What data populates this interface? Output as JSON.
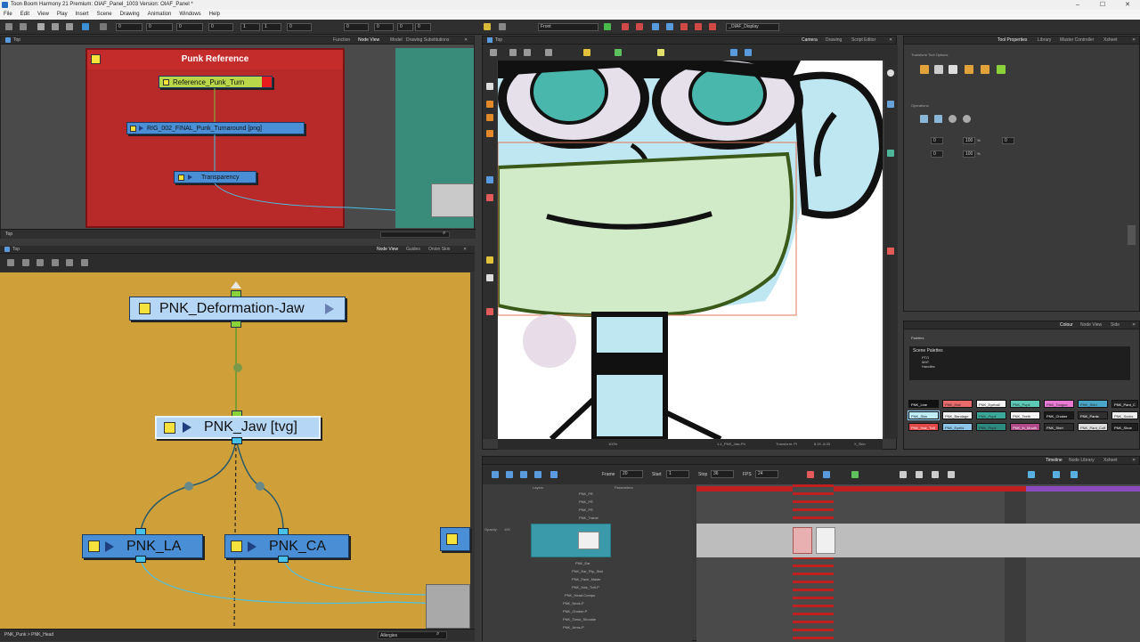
{
  "window": {
    "title": "Toon Boom Harmony 21 Premium: OIAF_Panel_1003 Version: OIAF_Panel *",
    "controls": [
      "–",
      "☐",
      "✕"
    ]
  },
  "menu": [
    "File",
    "Edit",
    "View",
    "Play",
    "Insert",
    "Scene",
    "Drawing",
    "Animation",
    "Windows",
    "Help"
  ],
  "toolbar": {
    "fields": [
      "0",
      "0",
      "0",
      "0",
      "0",
      "1",
      "1",
      "0",
      "0",
      "0",
      "0"
    ],
    "view_select": "Front",
    "display_select": "_OIAF_Display"
  },
  "top_node_view": {
    "crumb": "Top",
    "tabs": [
      "Function",
      "Node View",
      "Model",
      "Drawing Substitutions"
    ],
    "backdrop_title": "Punk Reference",
    "nodes": {
      "reference": "Reference_Punk_Turn",
      "rig": "RIG_002_FINAL_Punk_Turnaround [png]",
      "transparency": "Transparency"
    },
    "footer_crumb": "Top"
  },
  "bottom_node_view": {
    "crumb": "Top",
    "tabs": [
      "Node View",
      "Guides",
      "Onion Skin"
    ],
    "nodes": {
      "deformation": "PNK_Deformation-Jaw",
      "jaw": "PNK_Jaw [tvg]",
      "la": "PNK_LA",
      "ca": "PNK_CA"
    },
    "footer_crumb": "PNK_Punk > PNK_Head",
    "search_value": "Allergies"
  },
  "camera_view": {
    "crumb": "Top",
    "tabs": [
      "Camera",
      "Drawing",
      "Script Editor"
    ],
    "status": {
      "zoom": "100%",
      "layer": "1-1_PNK_Jaw-Ph",
      "mode": "Transform: Pi",
      "coords": "8.19 -8.03",
      "tool": "X_Skin"
    }
  },
  "tool_properties": {
    "tabs": [
      "Tool Properties",
      "Library",
      "Master Controller",
      "Xsheet"
    ],
    "section_title": "Transform Tool Options",
    "operations_label": "Operations",
    "fields": [
      "0",
      "100",
      "0",
      "0",
      "100",
      "0"
    ],
    "percent_symbols": [
      "%",
      "%"
    ]
  },
  "colour": {
    "tabs": [
      "Colour",
      "Node View",
      "Side"
    ],
    "palettes_label": "Palettes",
    "scene_palettes_label": "Scene Palettes",
    "palette_items": [
      "PTO",
      "MAT",
      "Handles"
    ],
    "swatches": [
      {
        "name": "PNK_Line",
        "color": "#111111",
        "text": "#ffffff"
      },
      {
        "name": "PNK_Hair",
        "color": "#e86a6a",
        "text": "#222222"
      },
      {
        "name": "PNK_Eyeball",
        "color": "#f5f5f5",
        "text": "#222222"
      },
      {
        "name": "PNK_Pupil",
        "color": "#5fc9b8",
        "text": "#222222"
      },
      {
        "name": "PNK_Tongue",
        "color": "#e97ad6",
        "text": "#222222"
      },
      {
        "name": "PNK_Shirt",
        "color": "#4aa6c8",
        "text": "#222222"
      },
      {
        "name": "PNK_Pant_C",
        "color": "#222222",
        "text": "#ffffff"
      },
      {
        "name": "PNK_Skin",
        "color": "#bfeefa",
        "text": "#222222"
      },
      {
        "name": "PNK_Bandage",
        "color": "#f0f0f0",
        "text": "#222222"
      },
      {
        "name": "PNK_Pupil",
        "color": "#3aa99a",
        "text": "#222222"
      },
      {
        "name": "PNK_Teeth",
        "color": "#f5f5f5",
        "text": "#222222"
      },
      {
        "name": "PNK_Choker",
        "color": "#1a1a1a",
        "text": "#ffffff"
      },
      {
        "name": "PNK_Pants",
        "color": "#303030",
        "text": "#ffffff"
      },
      {
        "name": "PNK_Socks",
        "color": "#eeeeee",
        "text": "#222222"
      },
      {
        "name": "PNK_Hair_Tuft",
        "color": "#e24a4a",
        "text": "#ffffff"
      },
      {
        "name": "PNK_Eyelid",
        "color": "#8dc6e8",
        "text": "#222222"
      },
      {
        "name": "PNK_Pupil",
        "color": "#2f8a7e",
        "text": "#222222"
      },
      {
        "name": "PNK_In_Mouth",
        "color": "#b04a8a",
        "text": "#ffffff"
      },
      {
        "name": "PNK_Shirt",
        "color": "#2b2b2b",
        "text": "#ffffff"
      },
      {
        "name": "PNK_Pant_Cuff",
        "color": "#dddddd",
        "text": "#222222"
      },
      {
        "name": "PNK_Shoe",
        "color": "#1e1e1e",
        "text": "#ffffff"
      }
    ]
  },
  "timeline": {
    "tabs": [
      "Timeline",
      "Node Library",
      "Xsheet"
    ],
    "frame_label": "Frame",
    "frame_value": "20",
    "start_label": "Start",
    "start_value": "1",
    "stop_label": "Stop",
    "stop_value": "36",
    "fps_label": "FPS",
    "fps_value": "24",
    "col_layers": "Layers",
    "col_params": "Parameters",
    "opacity_label": "Opacity:",
    "opacity_value": "100",
    "layers": [
      "PNK_FR",
      "PNK_FR",
      "PNK_FR",
      "PNK_Transf",
      "PNK_Ear",
      "PNK_Ear_Flip_Stat",
      "PNK_Face_Maste",
      "PNK_Hair_Tuft-P",
      "PNK_Head-Compo",
      "PNK_Neck-P",
      "PNK_Choker-P",
      "PNK_Torso_Shoulde",
      "PNK_Arms-P"
    ]
  }
}
